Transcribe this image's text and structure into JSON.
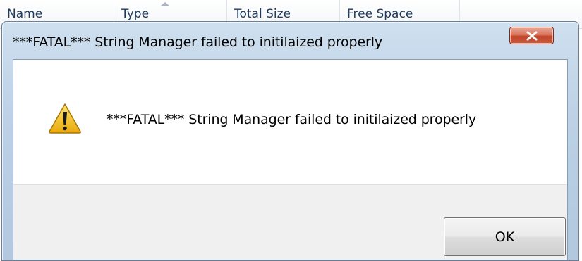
{
  "background_list": {
    "columns": [
      {
        "label": "Name"
      },
      {
        "label": "Type"
      },
      {
        "label": "Total Size"
      },
      {
        "label": "Free Space"
      }
    ],
    "sorted_column": "Type"
  },
  "dialog": {
    "title": "***FATAL*** String Manager failed to initilaized properly",
    "message": "***FATAL*** String Manager failed to initilaized properly",
    "icon": "warning-icon",
    "ok_label": "OK",
    "close_icon": "close-icon"
  },
  "colors": {
    "title_bar": "#bcd1e6",
    "close_button": "#c75b3e",
    "warning_fill": "#f5c518",
    "footer": "#f0f0f0"
  }
}
